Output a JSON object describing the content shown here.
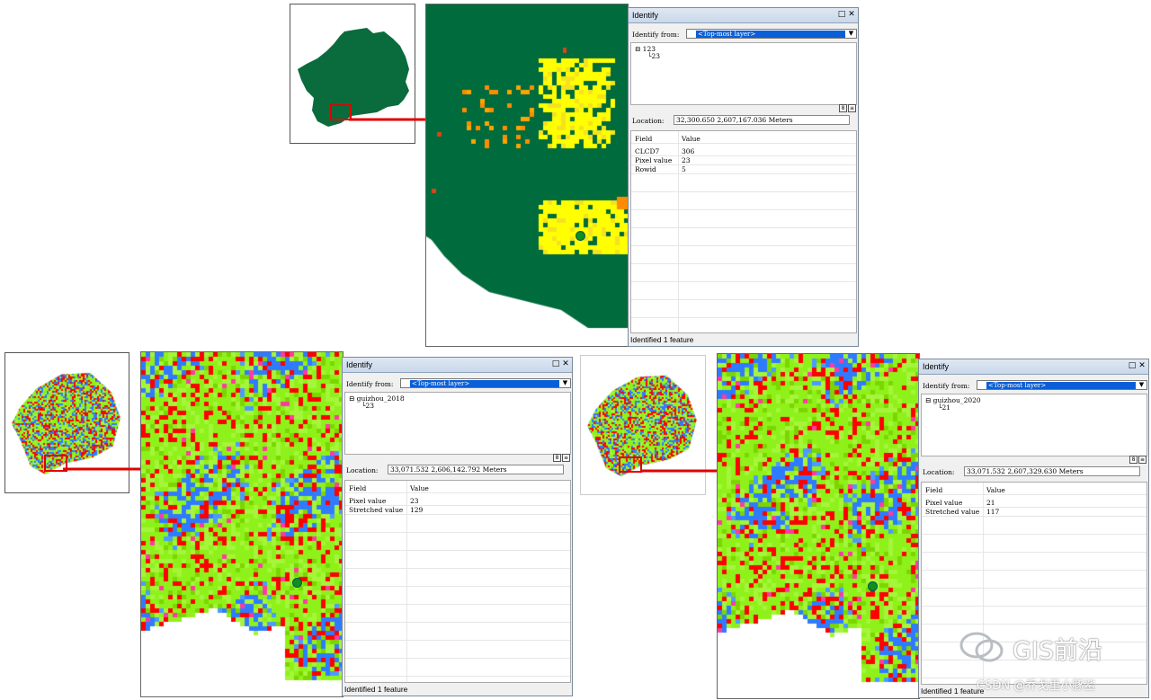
{
  "panels": {
    "top": {
      "window_title": "Identify",
      "identify_from_label": "Identify from:",
      "identify_from_value": "<Top-most layer>",
      "layer_name": "123",
      "layer_value": "23",
      "location_label": "Location:",
      "location_value": "32,300.650  2,607,167.036 Meters",
      "columns": [
        "Field",
        "Value"
      ],
      "rows": [
        [
          "CLCD7",
          "306"
        ],
        [
          "Pixel value",
          "23"
        ],
        [
          "Rowid",
          "5"
        ]
      ],
      "status": "Identified 1 feature",
      "map_palette": [
        "#006b3c",
        "#ffff00",
        "#f5e21f",
        "#ff8c00",
        "#ffa400",
        "#d9451b"
      ]
    },
    "left": {
      "window_title": "Identify",
      "identify_from_label": "Identify from:",
      "identify_from_value": "<Top-most layer>",
      "layer_name": "guizhou_2018",
      "layer_value": "23",
      "location_label": "Location:",
      "location_value": "33,071.532  2,606,142.792 Meters",
      "columns": [
        "Field",
        "Value"
      ],
      "rows": [
        [
          "Field",
          "Value"
        ],
        [
          "Pixel value",
          "23"
        ],
        [
          "Stretched value",
          "129"
        ]
      ],
      "status": "Identified 1 feature",
      "map_palette": [
        "#ff0000",
        "#2f7bff",
        "#8ef21a",
        "#a5f53b",
        "#4b9bff",
        "#ff3aa2",
        "#7bd600"
      ]
    },
    "right": {
      "window_title": "Identify",
      "identify_from_label": "Identify from:",
      "identify_from_value": "<Top-most layer>",
      "layer_name": "guizhou_2020",
      "layer_value": "21",
      "location_label": "Location:",
      "location_value": "33,071.532  2,607,329.630 Meters",
      "columns": [
        "Field",
        "Value"
      ],
      "rows": [
        [
          "Field",
          "Value"
        ],
        [
          "Pixel value",
          "21"
        ],
        [
          "Stretched value",
          "117"
        ]
      ],
      "status": "Identified 1 feature",
      "map_palette": [
        "#ff0000",
        "#2f7bff",
        "#8ef21a",
        "#a5f53b",
        "#4b9bff",
        "#ff3aa2",
        "#7bd600"
      ]
    }
  },
  "watermark": {
    "brand": "GIS前沿",
    "csdn": "CSDN @乔戈里小豚鲨"
  },
  "icons": {
    "close": "close-icon",
    "dock": "dock-icon",
    "dropdown": "chevron-down-icon",
    "tree_toggle": "tree-collapse-icon"
  },
  "colors": {
    "connector": "#e00000",
    "selection": "#0a5fd6",
    "location_dot": "#0f8f1f"
  }
}
